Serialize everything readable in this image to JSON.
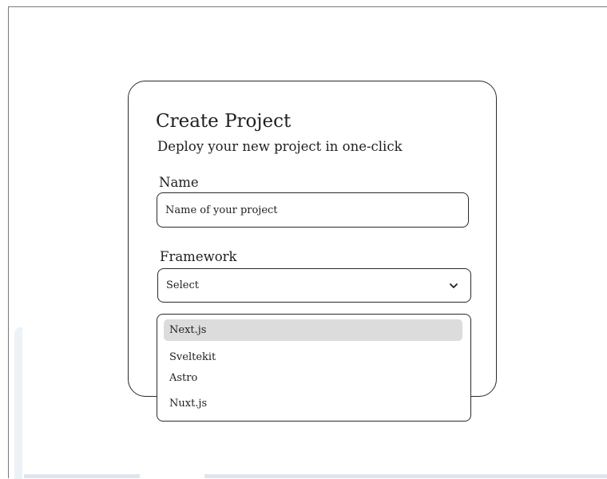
{
  "dialog": {
    "title": "Create Project",
    "subtitle": "Deploy your new project in one-click"
  },
  "form": {
    "name_label": "Name",
    "name_value": "Name of your project",
    "framework_label": "Framework",
    "framework_value": "Select",
    "chevron_icon": "chevron-down-icon"
  },
  "dropdown": {
    "options": [
      {
        "label": "Next.js",
        "highlighted": true
      },
      {
        "label": "Sveltekit",
        "highlighted": false
      },
      {
        "label": "Astro",
        "highlighted": false
      },
      {
        "label": "Nuxt.js",
        "highlighted": false
      }
    ]
  },
  "colors": {
    "border": "#2a2a2a",
    "highlight": "#dcdcdc",
    "background": "#ffffff"
  }
}
